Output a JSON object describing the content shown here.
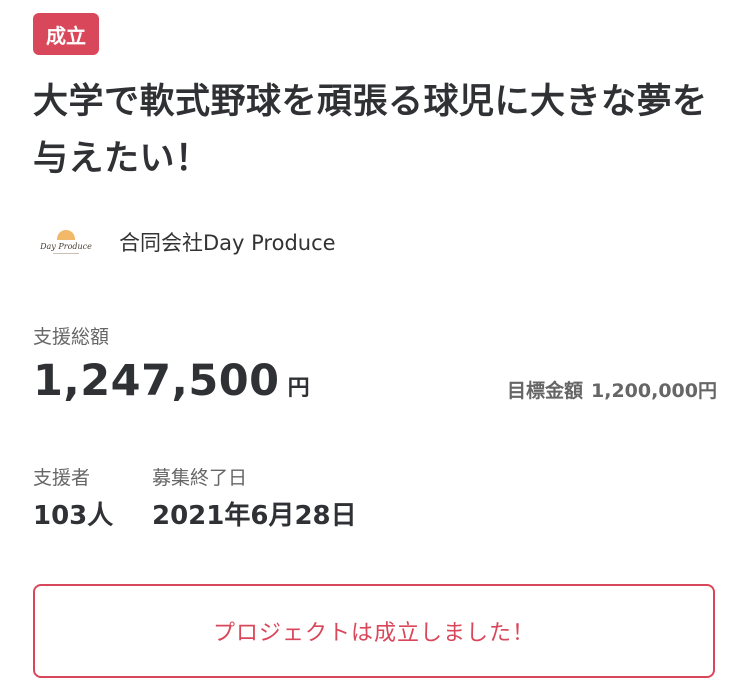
{
  "status_badge": "成立",
  "project_title": "大学で軟式野球を頑張る球児に大きな夢を与えたい！",
  "owner": {
    "logo_text": "Day Produce",
    "name": "合同会社Day Produce"
  },
  "funding": {
    "total_label": "支援総額",
    "total_value": "1,247,500",
    "total_unit": "円",
    "goal_label": "目標金額",
    "goal_value": "1,200,000円"
  },
  "stats": {
    "supporters_label": "支援者",
    "supporters_value": "103人",
    "end_date_label": "募集終了日",
    "end_date_value": "2021年6月28日"
  },
  "status_message": "プロジェクトは成立しました！",
  "colors": {
    "accent": "#d9475a",
    "text_dark": "#2f3134",
    "text_muted": "#666666"
  }
}
